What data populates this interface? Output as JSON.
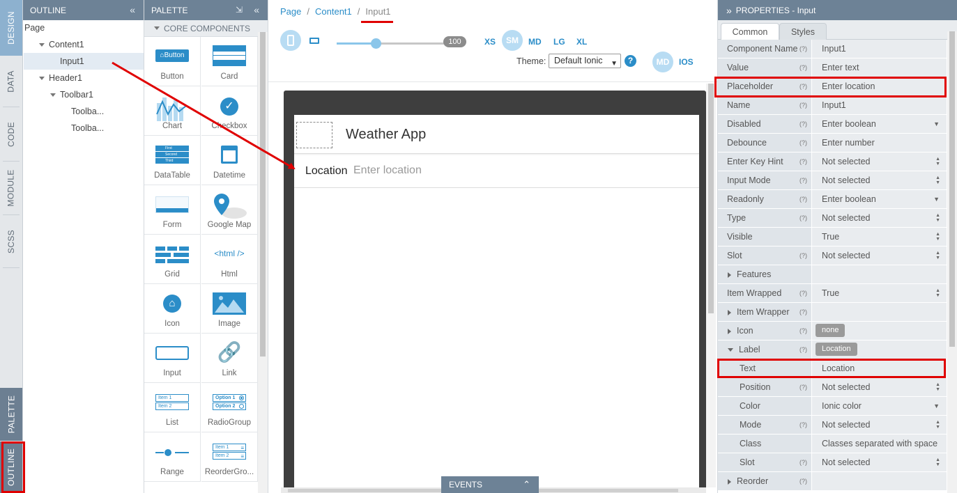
{
  "vertical_tabs": [
    "DESIGN",
    "DATA",
    "CODE",
    "MODULE",
    "SCSS",
    "PALETTE",
    "OUTLINE"
  ],
  "outline": {
    "title": "OUTLINE",
    "items": [
      "Page",
      "Content1",
      "Input1",
      "Header1",
      "Toolbar1",
      "Toolba...",
      "Toolba..."
    ]
  },
  "palette": {
    "title": "PALETTE",
    "section": "CORE COMPONENTS",
    "components": [
      "Button",
      "Card",
      "Chart",
      "Checkbox",
      "DataTable",
      "Datetime",
      "Form",
      "Google Map",
      "Grid",
      "Html",
      "Icon",
      "Image",
      "Input",
      "Link",
      "List",
      "RadioGroup",
      "Range",
      "ReorderGro..."
    ],
    "icon_texts": {
      "button": "Button",
      "html": "<html />",
      "datatable": [
        "First",
        "Second",
        "Third"
      ],
      "list": [
        "Item 1",
        "Item 2"
      ],
      "radio": [
        "Option 1",
        "Option 2"
      ],
      "reorder": [
        "Item 1",
        "Item 2"
      ]
    }
  },
  "breadcrumb": [
    "Page",
    "Content1",
    "Input1"
  ],
  "toolbar": {
    "zoom": "100",
    "sizes": [
      "XS",
      "SM",
      "MD",
      "LG",
      "XL"
    ],
    "theme_label": "Theme:",
    "theme_value": "Default Ionic",
    "help": "?",
    "modes": [
      "MD",
      "IOS"
    ]
  },
  "device": {
    "app_title": "Weather App",
    "input_label": "Location",
    "input_placeholder": "Enter location"
  },
  "events_label": "EVENTS",
  "properties": {
    "title": "PROPERTIES - Input",
    "tabs": [
      "Common",
      "Styles"
    ],
    "help_mark": "(?)",
    "rows": [
      {
        "k": "Component Name",
        "v": "Input1"
      },
      {
        "k": "Value",
        "v": "Enter text"
      },
      {
        "k": "Placeholder",
        "v": "Enter location"
      },
      {
        "k": "Name",
        "v": "Input1"
      },
      {
        "k": "Disabled",
        "v": "Enter boolean"
      },
      {
        "k": "Debounce",
        "v": "Enter number"
      },
      {
        "k": "Enter Key Hint",
        "v": "Not selected"
      },
      {
        "k": "Input Mode",
        "v": "Not selected"
      },
      {
        "k": "Readonly",
        "v": "Enter boolean"
      },
      {
        "k": "Type",
        "v": "Not selected"
      },
      {
        "k": "Visible",
        "v": "True"
      },
      {
        "k": "Slot",
        "v": "Not selected"
      },
      {
        "k": "Features",
        "v": ""
      },
      {
        "k": "Item Wrapped",
        "v": "True"
      },
      {
        "k": "Item Wrapper",
        "v": ""
      },
      {
        "k": "Icon",
        "v": "none"
      },
      {
        "k": "Label",
        "v": "Location"
      },
      {
        "k": "Text",
        "v": "Location"
      },
      {
        "k": "Position",
        "v": "Not selected"
      },
      {
        "k": "Color",
        "v": "Ionic color"
      },
      {
        "k": "Mode",
        "v": "Not selected"
      },
      {
        "k": "Class",
        "v": "Classes separated with space"
      },
      {
        "k": "Slot",
        "v": "Not selected"
      },
      {
        "k": "Reorder",
        "v": ""
      }
    ]
  },
  "colors": {
    "header": "#6d8296",
    "accent": "#2b8dc8",
    "highlight": "#e00000"
  }
}
